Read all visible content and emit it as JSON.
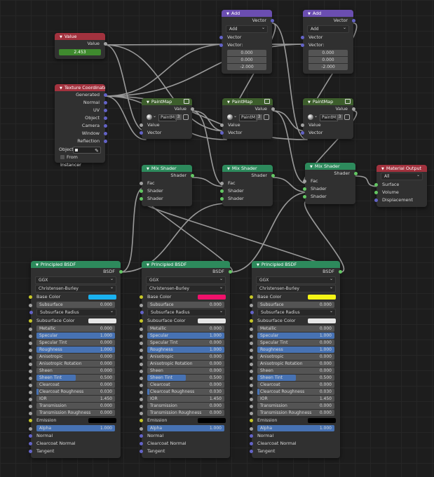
{
  "colors": {
    "wire": "#9a9a9a",
    "shader_header": "#2d8a5c",
    "vector_header": "#6b4eb1",
    "input_header": "#a2323e",
    "texture_header": "#3d5e2c"
  },
  "value_node": {
    "title": "Value",
    "out": "Value",
    "value": "2.453"
  },
  "texcoord_node": {
    "title": "Texture Coordinate",
    "outputs": [
      "Generated",
      "Normal",
      "UV",
      "Object",
      "Camera",
      "Window",
      "Reflection"
    ],
    "object_label": "Object:",
    "from_instancer": "From Instancer"
  },
  "add_node": {
    "title": "Add",
    "out": "Vector",
    "mode": "Add",
    "in1": "Vector",
    "in2": "Vector:",
    "vals": [
      "0.000",
      "0.000",
      "-2.000"
    ]
  },
  "paintmap_node": {
    "title": "PaintMap",
    "out": "Value",
    "texture": "PaintM",
    "users": "3",
    "in1": "Value",
    "in2": "Vector"
  },
  "mix_node": {
    "title": "Mix Shader",
    "out": "Shader",
    "fac": "Fac",
    "in1": "Shader",
    "in2": "Shader"
  },
  "output_node": {
    "title": "Material Output",
    "target": "All",
    "inputs": [
      "Surface",
      "Volume",
      "Displacement"
    ]
  },
  "bsdf": {
    "title": "Principled BSDF",
    "out": "BSDF",
    "distribution": "GGX",
    "subsurface_method": "Christensen-Burley",
    "base_color": "Base Color",
    "subsurface": "Subsurface",
    "subsurface_val": "0.000",
    "subsurface_radius": "Subsurface Radius",
    "subsurface_color": "Subsurface Color",
    "rows": [
      {
        "label": "Metallic",
        "value": "0.000",
        "fill": 0
      },
      {
        "label": "Specular",
        "value": "1.000",
        "fill": 1
      },
      {
        "label": "Specular Tint",
        "value": "0.000",
        "fill": 0
      },
      {
        "label": "Roughness",
        "value": "1.000",
        "fill": 1
      },
      {
        "label": "Anisotropic",
        "value": "0.000",
        "fill": 0
      },
      {
        "label": "Anisotropic Rotation",
        "value": "0.000",
        "fill": 0
      },
      {
        "label": "Sheen",
        "value": "0.000",
        "fill": 0
      },
      {
        "label": "Sheen Tint",
        "value": "0.500",
        "fill": 0.5
      },
      {
        "label": "Clearcoat",
        "value": "0.000",
        "fill": 0
      },
      {
        "label": "Clearcoat Roughness",
        "value": "0.030",
        "fill": 0.03
      },
      {
        "label": "IOR",
        "value": "1.450",
        "fill": 0
      },
      {
        "label": "Transmission",
        "value": "0.000",
        "fill": 0
      },
      {
        "label": "Transmission Roughness",
        "value": "0.000",
        "fill": 0
      }
    ],
    "emission": "Emission",
    "alpha": "Alpha",
    "alpha_val": "1.000",
    "normal": "Normal",
    "clearcoat_normal": "Clearcoat Normal",
    "tangent": "Tangent",
    "base_colors": [
      "#1ab2f0",
      "#f0116b",
      "#f5f516"
    ],
    "emission_color": "#000000",
    "subsurface_color_value": "#e6e6e6"
  }
}
